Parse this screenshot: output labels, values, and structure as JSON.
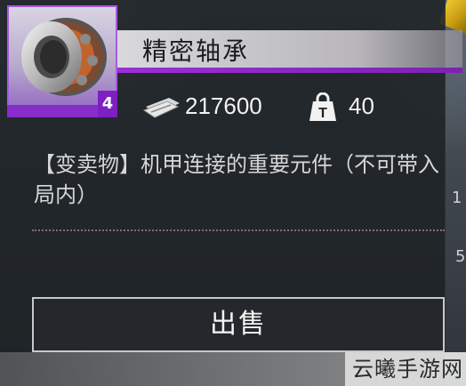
{
  "item": {
    "name": "精密轴承",
    "level": "4",
    "price": "217600",
    "weight": "40",
    "description": "【变卖物】机甲连接的重要元件（不可带入局内）"
  },
  "actions": {
    "sell_label": "出售"
  },
  "side_text": {
    "top": "1",
    "bottom": "5"
  },
  "watermark": "云曦手游网",
  "colors": {
    "rarity_purple": "#8a2bcc",
    "name_bar": "#d9d9dc",
    "panel_bg": "#1e2226"
  },
  "icons": {
    "price": "cash-icon",
    "weight": "weight-icon",
    "item": "bearing-icon"
  }
}
